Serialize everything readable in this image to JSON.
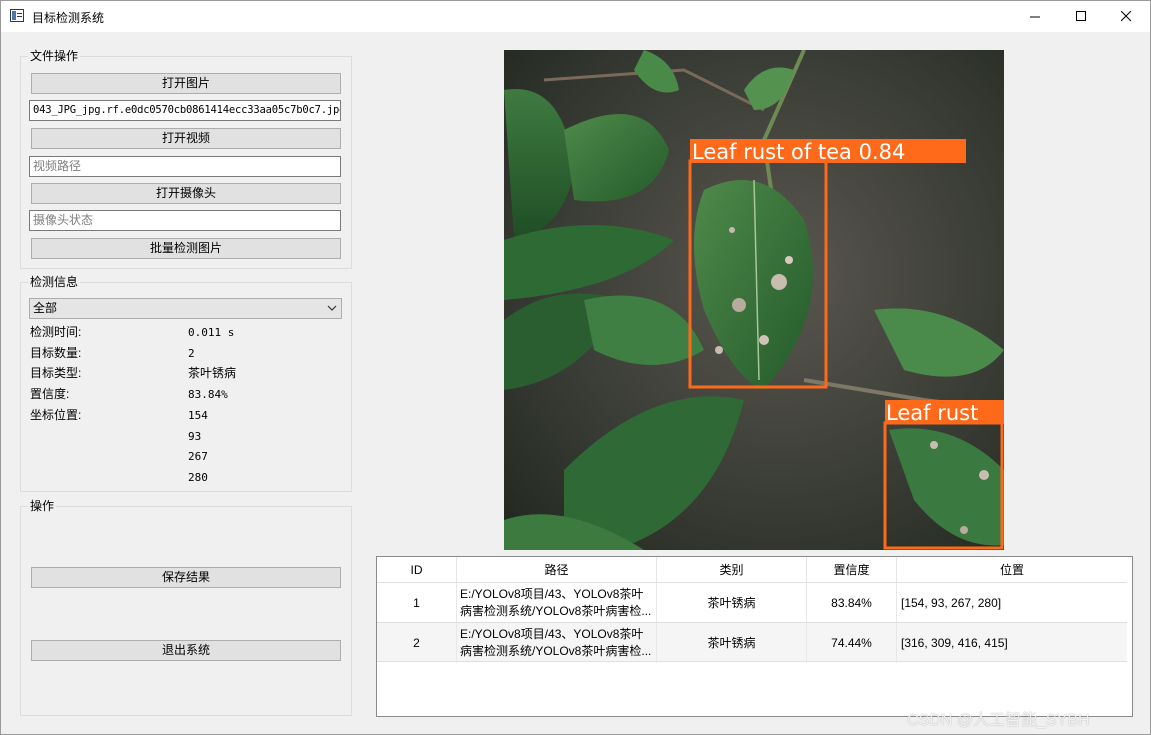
{
  "window": {
    "title": "目标检测系统"
  },
  "file_ops": {
    "title": "文件操作",
    "open_image_label": "打开图片",
    "image_path_value": "043_JPG_jpg.rf.e0dc0570cb0861414ecc33aa05c7b0c7.jpg",
    "open_video_label": "打开视频",
    "video_path_placeholder": "视频路径",
    "open_camera_label": "打开摄像头",
    "camera_status_placeholder": "摄像头状态",
    "batch_detect_label": "批量检测图片"
  },
  "detect_info": {
    "title": "检测信息",
    "target_select_value": "全部",
    "time_label": "检测时间:",
    "time_value": "0.011 s",
    "count_label": "目标数量:",
    "count_value": "2",
    "type_label": "目标类型:",
    "type_value": "茶叶锈病",
    "confidence_label": "置信度:",
    "confidence_value": "83.84%",
    "position_label": "坐标位置:",
    "xmin": "154",
    "ymin": "93",
    "xmax": "267",
    "ymax": "280"
  },
  "operations": {
    "title": "操作",
    "save_label": "保存结果",
    "exit_label": "退出系统"
  },
  "detection_image": {
    "labels": [
      "Leaf rust of tea 0.84",
      "Leaf rust"
    ],
    "box_color": "#ff6a1a"
  },
  "results_table": {
    "headers": [
      "ID",
      "路径",
      "类别",
      "置信度",
      "位置"
    ],
    "rows": [
      {
        "id": "1",
        "path_line1": "E:/YOLOv8项目/43、YOLOv8茶叶",
        "path_line2": "病害检测系统/YOLOv8茶叶病害检...",
        "category": "茶叶锈病",
        "confidence": "83.84%",
        "position": "[154, 93, 267, 280]"
      },
      {
        "id": "2",
        "path_line1": "E:/YOLOv8项目/43、YOLOv8茶叶",
        "path_line2": "病害检测系统/YOLOv8茶叶病害检...",
        "category": "茶叶锈病",
        "confidence": "74.44%",
        "position": "[316, 309, 416, 415]"
      }
    ]
  },
  "watermark": "CSDN @人工智能_SYBH"
}
